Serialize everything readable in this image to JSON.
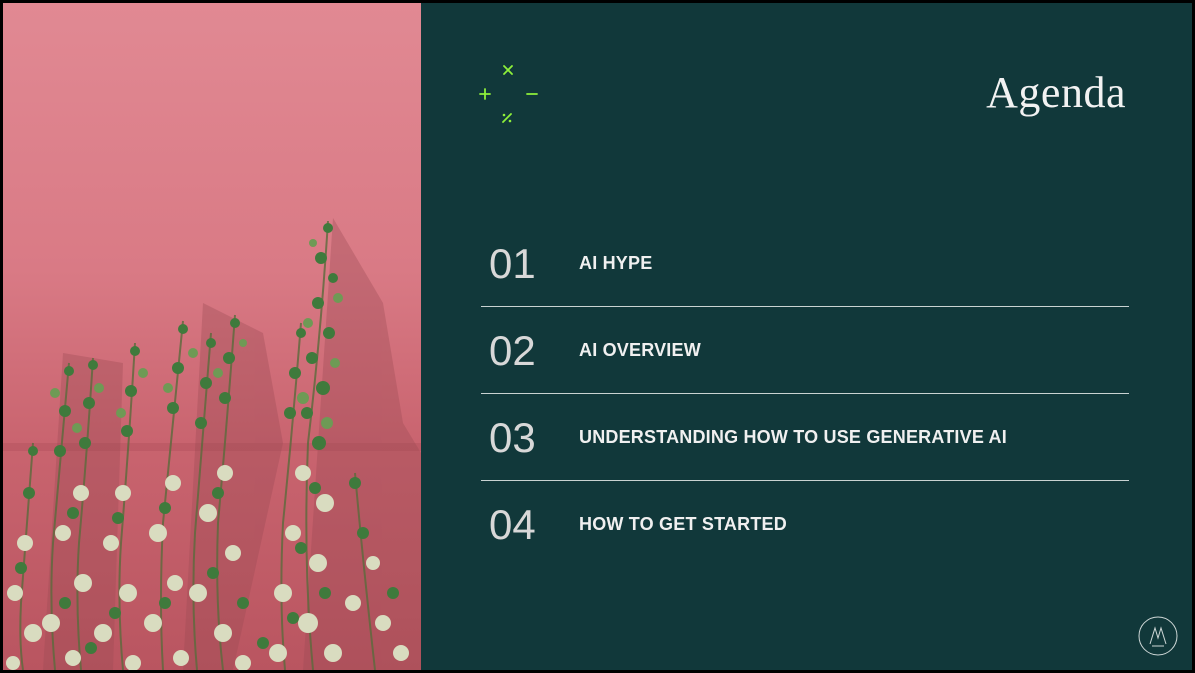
{
  "slide": {
    "title": "Agenda",
    "items": [
      {
        "number": "01",
        "label": "AI HYPE"
      },
      {
        "number": "02",
        "label": "AI OVERVIEW"
      },
      {
        "number": "03",
        "label": "UNDERSTANDING HOW TO USE GENERATIVE AI"
      },
      {
        "number": "04",
        "label": "HOW TO GET STARTED"
      }
    ],
    "decoration_glyphs": [
      "×",
      "+",
      "−",
      "%"
    ]
  },
  "colors": {
    "panel_background": "#11383a",
    "photo_wall": "#d97a85",
    "accent_green": "#8ef03a",
    "divider": "#c9d3d2"
  },
  "icons": [
    "math-symbols-icon",
    "logo-mark-icon"
  ]
}
